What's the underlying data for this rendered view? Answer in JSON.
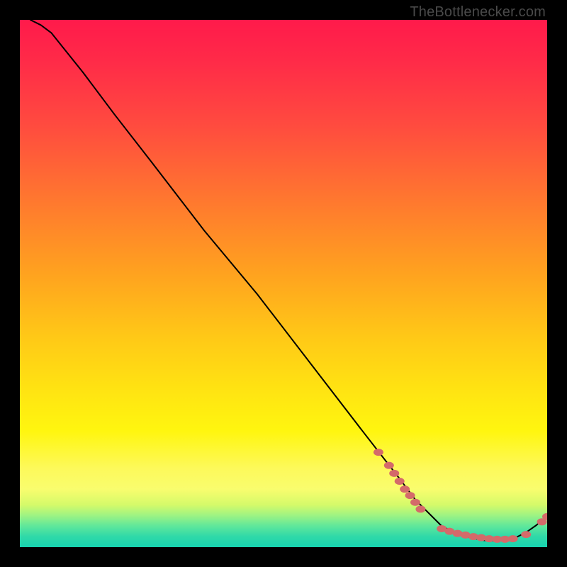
{
  "watermark": "TheBottlenecker.com",
  "chart_data": {
    "type": "line",
    "title": "",
    "xlabel": "",
    "ylabel": "",
    "xlim": [
      0,
      100
    ],
    "ylim": [
      0,
      100
    ],
    "background": "rainbow-vertical",
    "series": [
      {
        "name": "curve",
        "stroke": "#000000",
        "x": [
          2,
          4,
          6,
          8,
          12,
          18,
          25,
          35,
          45,
          55,
          65,
          72,
          75,
          78,
          80,
          82,
          84,
          86,
          88,
          90,
          92,
          94,
          96,
          98,
          100
        ],
        "values": [
          100,
          99,
          97.5,
          95,
          90,
          82,
          73,
          60,
          48,
          35,
          22,
          13,
          9,
          6,
          4,
          3,
          2.2,
          1.7,
          1.3,
          1.2,
          1.3,
          1.8,
          2.8,
          4.2,
          6
        ]
      },
      {
        "name": "markers-upper",
        "type": "scatter",
        "marker": "ellipse",
        "color": "#d46a6a",
        "x": [
          68,
          70,
          71,
          72,
          73,
          74,
          75,
          76
        ],
        "values": [
          18,
          15.5,
          14,
          12.5,
          11,
          9.8,
          8.5,
          7.2
        ]
      },
      {
        "name": "markers-lower",
        "type": "scatter",
        "marker": "ellipse",
        "color": "#d46a6a",
        "x": [
          80,
          81.5,
          83,
          84.5,
          86,
          87.5,
          89,
          90.5,
          92,
          93.5,
          96,
          99,
          100
        ],
        "values": [
          3.5,
          3.0,
          2.6,
          2.3,
          2.0,
          1.8,
          1.6,
          1.5,
          1.5,
          1.6,
          2.4,
          4.8,
          5.8
        ]
      }
    ]
  }
}
